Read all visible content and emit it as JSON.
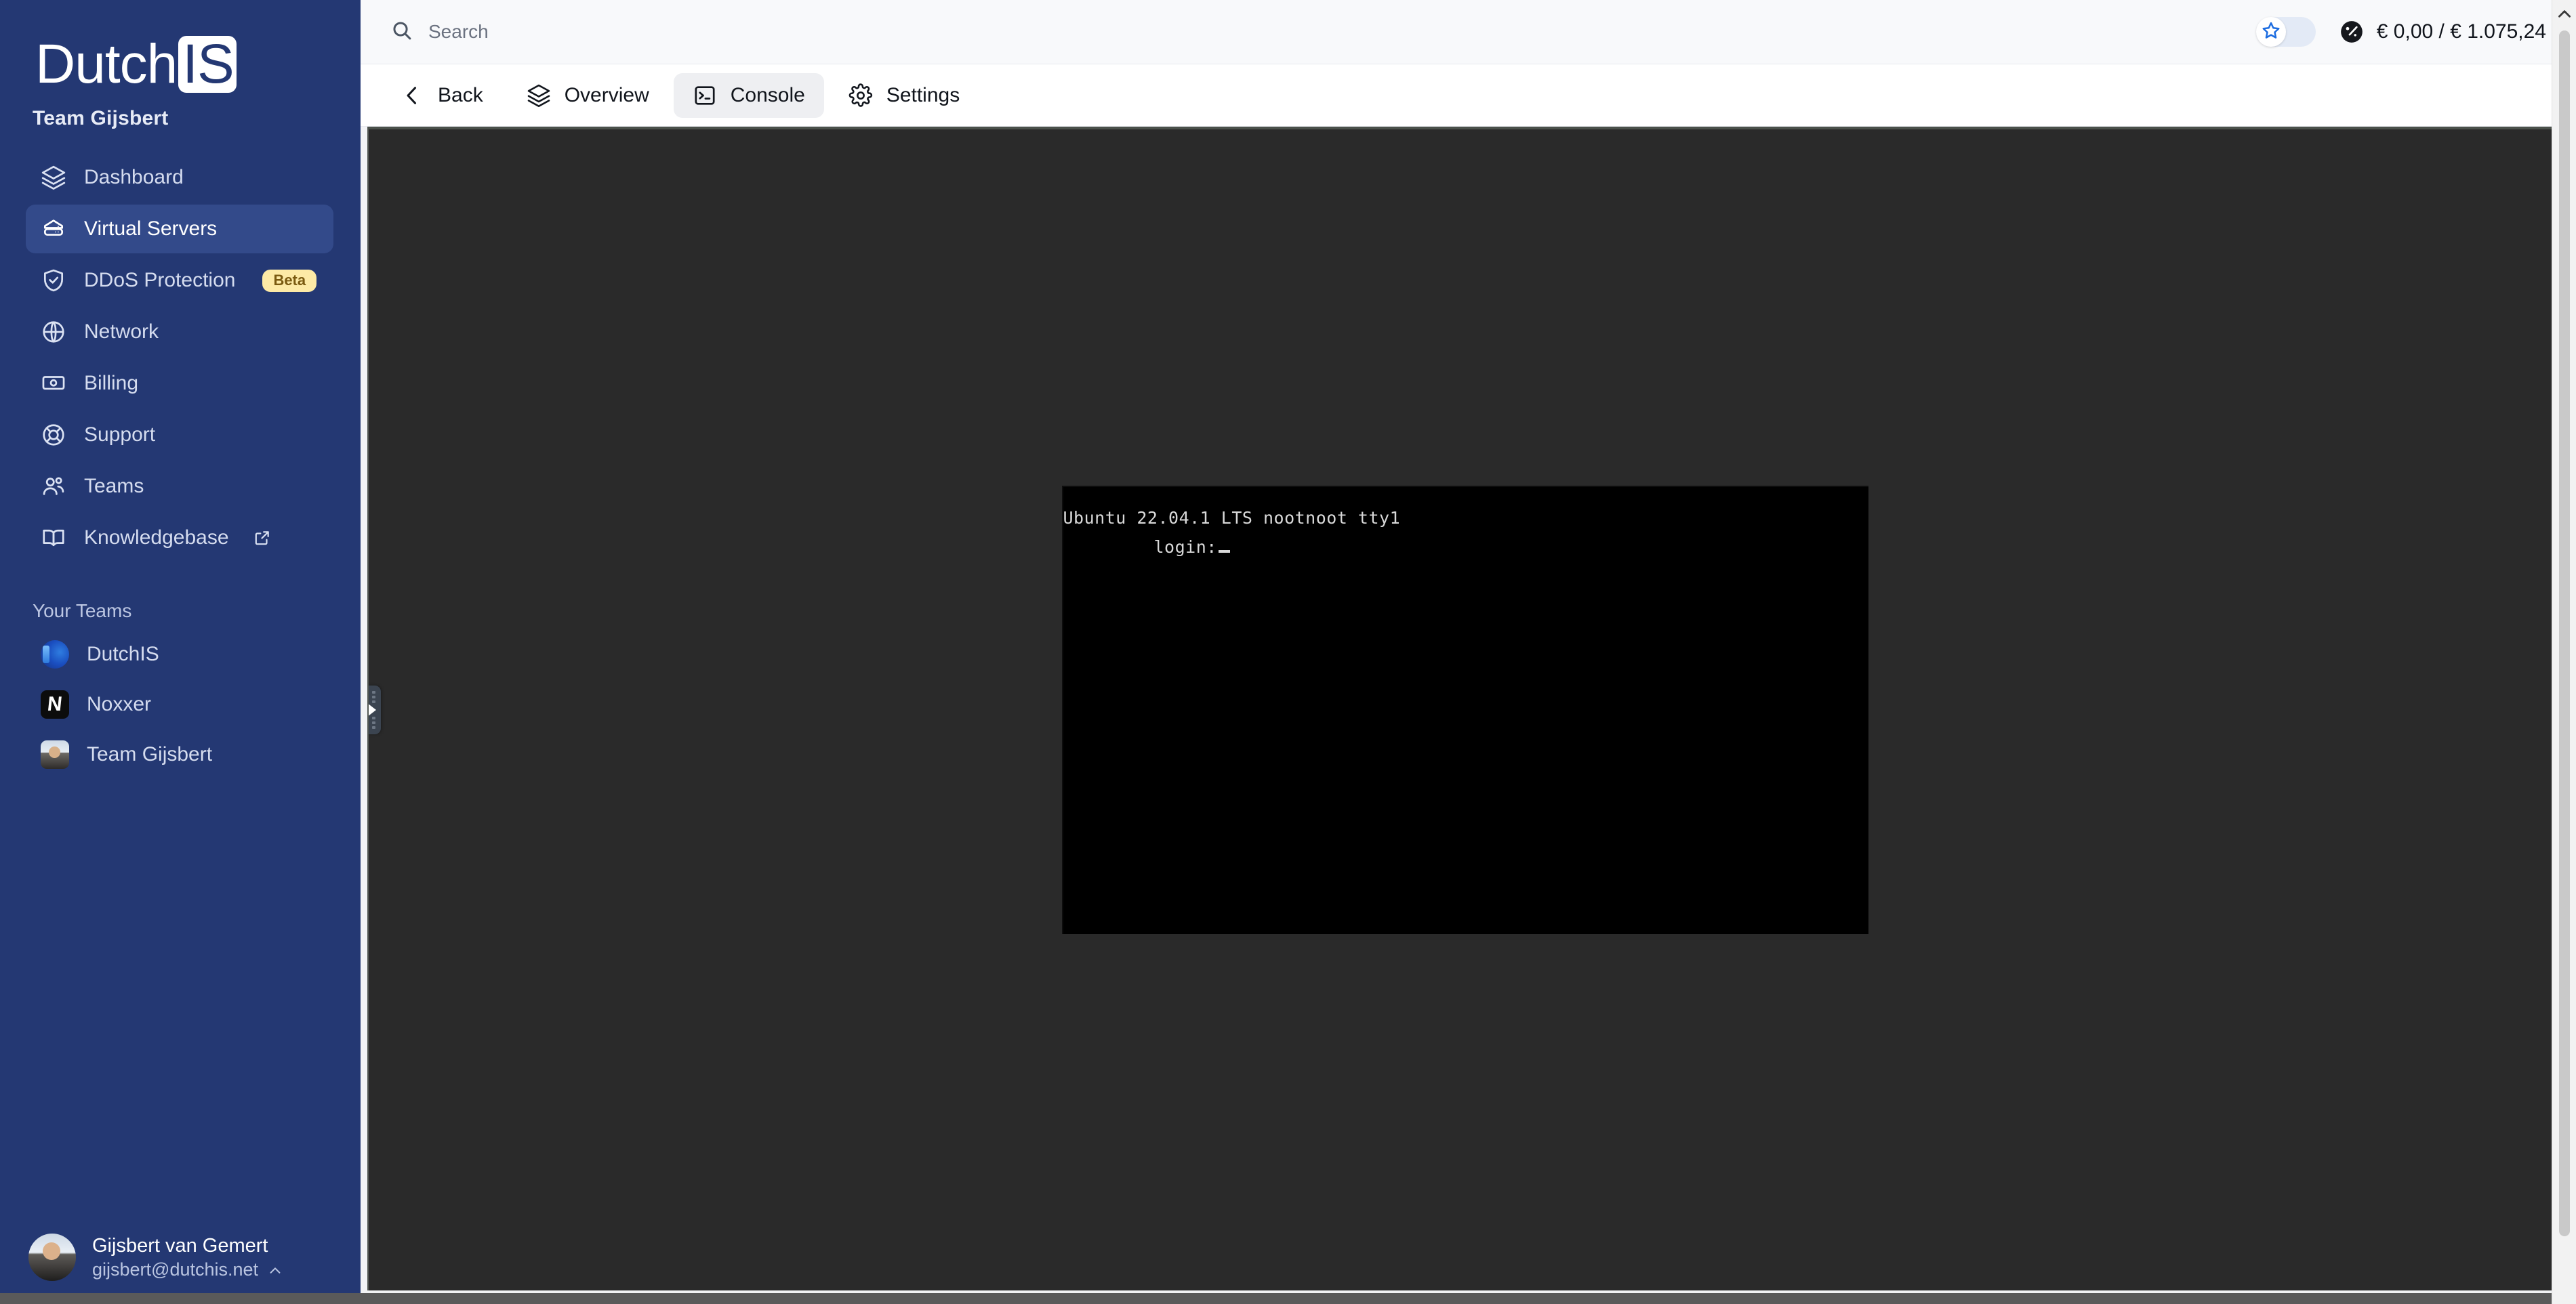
{
  "brand": {
    "name_main": "Dutch",
    "name_mark": "IS"
  },
  "sidebar": {
    "team_title": "Team Gijsbert",
    "nav": [
      {
        "label": "Dashboard",
        "icon": "layers-icon"
      },
      {
        "label": "Virtual Servers",
        "icon": "server-icon"
      },
      {
        "label": "DDoS Protection",
        "icon": "shield-check-icon",
        "badge": "Beta"
      },
      {
        "label": "Network",
        "icon": "globe-icon"
      },
      {
        "label": "Billing",
        "icon": "banknote-icon"
      },
      {
        "label": "Support",
        "icon": "life-ring-icon"
      },
      {
        "label": "Teams",
        "icon": "users-icon"
      },
      {
        "label": "Knowledgebase",
        "icon": "book-icon",
        "external": true
      }
    ],
    "teams_section_label": "Your Teams",
    "teams": [
      {
        "label": "DutchIS",
        "avatar": "dutchis-logo-avatar"
      },
      {
        "label": "Noxxer",
        "avatar": "noxxer-logo-avatar"
      },
      {
        "label": "Team Gijsbert",
        "avatar": "team-gijsbert-photo-avatar"
      }
    ],
    "user": {
      "name": "Gijsbert van Gemert",
      "email": "gijsbert@dutchis.net",
      "chevron": "chevron-up-icon"
    }
  },
  "topbar": {
    "search_placeholder": "Search",
    "search_value": "",
    "search_icon": "search-icon",
    "favorite_toggle_icon": "star-icon",
    "favorite_toggle_on": false,
    "credit_icon": "gauge-icon",
    "credit_text": "€ 0,00 / € 1.075,24"
  },
  "tabbar": [
    {
      "label": "Back",
      "icon": "chevron-left-icon",
      "active": false
    },
    {
      "label": "Overview",
      "icon": "layers-icon",
      "active": false
    },
    {
      "label": "Console",
      "icon": "terminal-icon",
      "active": true
    },
    {
      "label": "Settings",
      "icon": "gear-icon",
      "active": false
    }
  ],
  "console": {
    "line1": "Ubuntu 22.04.1 LTS nootnoot tty1",
    "line2": "login:",
    "cursor": "block-cursor"
  },
  "colors": {
    "sidebar_bg": "#243873",
    "sidebar_active": "#334a8a",
    "badge_beta_bg": "#fdeaa6",
    "badge_beta_text": "#7a5a10",
    "accent_blue": "#1c6ce0",
    "console_bg": "#2a2a2a",
    "terminal_bg": "#000000",
    "terminal_text": "#d9d9d9"
  }
}
